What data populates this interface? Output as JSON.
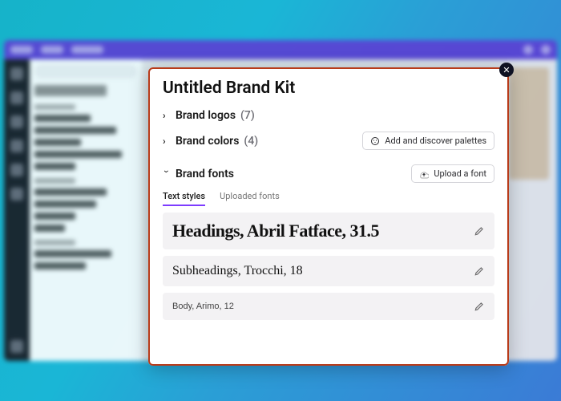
{
  "modal": {
    "title": "Untitled Brand Kit",
    "close_aria": "Close",
    "sections": {
      "logos": {
        "label": "Brand logos",
        "count": "(7)"
      },
      "colors": {
        "label": "Brand colors",
        "count": "(4)",
        "action": "Add and discover palettes"
      },
      "fonts": {
        "label": "Brand fonts",
        "action": "Upload a font"
      }
    },
    "tabs": {
      "text_styles": "Text styles",
      "uploaded_fonts": "Uploaded fonts"
    },
    "styles": {
      "heading": "Headings, Abril Fatface, 31.5",
      "subheading": "Subheadings, Trocchi, 18",
      "body": "Body, Arimo, 12"
    }
  }
}
